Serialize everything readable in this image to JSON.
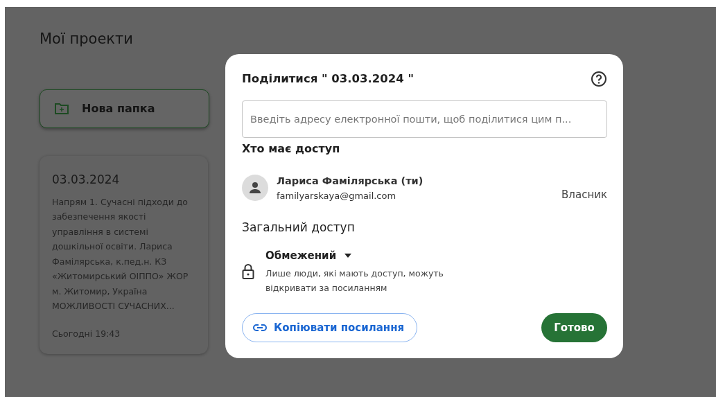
{
  "page": {
    "title": "Мої проекти"
  },
  "new_folder_button": {
    "label": "Нова папка"
  },
  "projects": [
    {
      "title": "03.03.2024",
      "description": "Напрям 1. Сучасні підходи до забезпечення якості управління в системі дошкільної освіти. Лариса Фамілярська, к.пед.н. КЗ «Житомирський ОІППО» ЖОР м. Житомир, Україна МОЖЛИВОСТІ СУЧАСНИХ...",
      "time": "Сьогодні 19:43"
    }
  ],
  "share_dialog": {
    "title": "Поділитися \" 03.03.2024 \"",
    "email_field": {
      "placeholder": "Введіть адресу електронної пошти, щоб поділитися цим п..."
    },
    "people_heading": "Хто має доступ",
    "people": [
      {
        "name": "Лариса Фамілярська (ти)",
        "email": "familyarskaya@gmail.com",
        "role": "Власник"
      }
    ],
    "general_heading": "Загальний доступ",
    "general_access": {
      "level": "Обмежений",
      "description": "Лише люди, які мають доступ, можуть відкривати за посиланням"
    },
    "copy_link_button": "Копіювати посилання",
    "done_button": "Готово"
  }
}
